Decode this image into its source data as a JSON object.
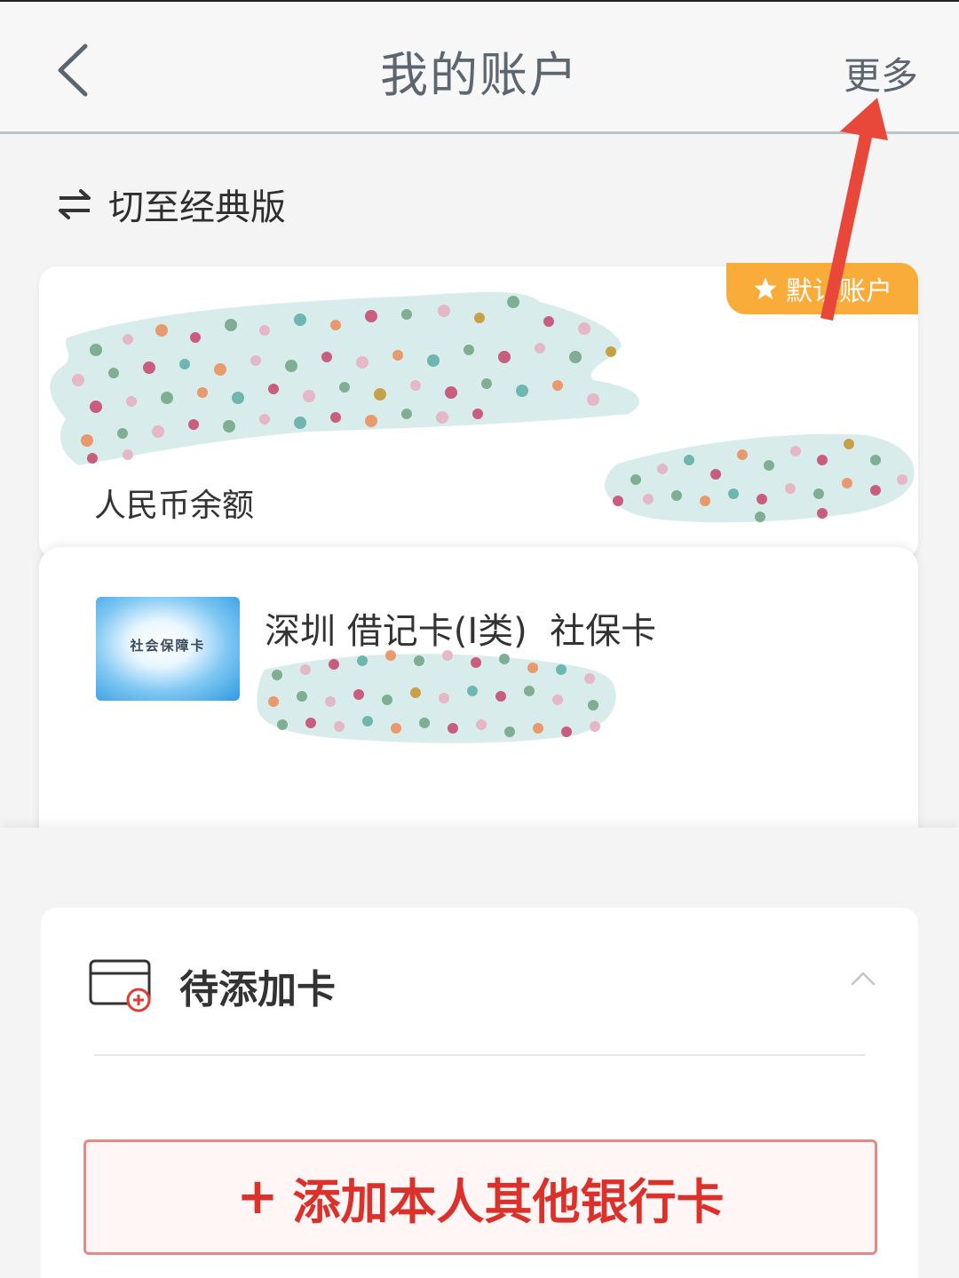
{
  "header": {
    "title": "我的账户",
    "more_label": "更多"
  },
  "switch": {
    "label": "切至经典版"
  },
  "account": {
    "default_badge": "默认账户",
    "balance_label": "人民币余额"
  },
  "card": {
    "thumb_text": "社会保障卡",
    "name": "深圳 借记卡(I类)  社保卡"
  },
  "pending": {
    "title": "待添加卡",
    "add_button_plus": "+",
    "add_button_label": "添加本人其他银行卡"
  },
  "colors": {
    "accent_red": "#dc302b",
    "badge_orange": "#f9ac3a",
    "annotation_arrow": "#e8473a"
  }
}
